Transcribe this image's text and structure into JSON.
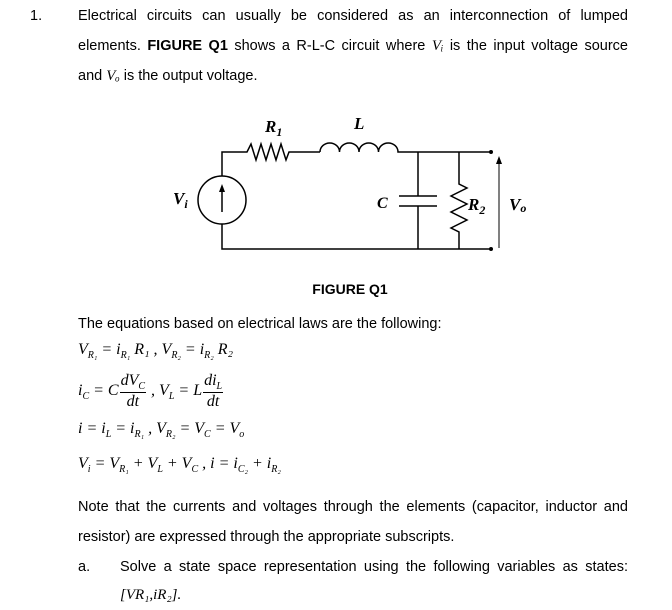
{
  "question": {
    "number": "1.",
    "line1": "Electrical circuits can usually be considered as an interconnection of lumped",
    "line2_pre": "elements. ",
    "line2_bold": "FIGURE Q1",
    "line2_post": " shows a R-L-C circuit where ",
    "line2_var": "Vᵢ",
    "line2_end": " is the input voltage source",
    "line3_pre": "and ",
    "line3_var": "Vₒ",
    "line3_end": " is the output voltage."
  },
  "figure": {
    "caption": "FIGURE Q1",
    "labels": {
      "R1": "R",
      "R1_sub": "1",
      "L": "L",
      "Vi": "V",
      "Vi_sub": "i",
      "C": "C",
      "R2": "R",
      "R2_sub": "2",
      "Vo": "V",
      "Vo_sub": "o"
    }
  },
  "intro": "The equations based on electrical laws are the following:",
  "equations": [
    [
      {
        "t": "V",
        "s": "R₁"
      },
      {
        "t": " = i",
        "s": "R₁"
      },
      {
        "t": " R₁ ,  V",
        "s": "R₂"
      },
      {
        "t": " = i",
        "s": "R₂"
      },
      {
        "t": " R₂"
      }
    ],
    [
      {
        "t": "i",
        "s": "C"
      },
      {
        "t": " = C"
      },
      {
        "f": [
          "dV_C",
          "dt"
        ]
      },
      {
        "t": " ,  V",
        "s": "L"
      },
      {
        "t": " = L"
      },
      {
        "f": [
          "di_L",
          "dt"
        ]
      }
    ],
    [
      {
        "t": "i = i",
        "s": "L"
      },
      {
        "t": " = i",
        "s": "R₁"
      },
      {
        "t": " ,  V",
        "s": "R₂"
      },
      {
        "t": " = V",
        "s": "C"
      },
      {
        "t": " = V",
        "s": "o"
      }
    ],
    [
      {
        "t": "V",
        "s": "i"
      },
      {
        "t": " = V",
        "s": "R₁"
      },
      {
        "t": " + V",
        "s": "L"
      },
      {
        "t": " + V",
        "s": "C"
      },
      {
        "t": " ,  i = i",
        "s": "C₂"
      },
      {
        "t": " + i",
        "s": "R₂"
      }
    ]
  ],
  "note_line1": "Note that the currents and voltages through the elements (capacitor, inductor and",
  "note_line2": "resistor) are expressed through the appropriate subscripts.",
  "part_a": {
    "label": "a.",
    "line1": "Solve a state space representation using the following variables as states:",
    "line2": "[VR₁,iR₂]."
  }
}
